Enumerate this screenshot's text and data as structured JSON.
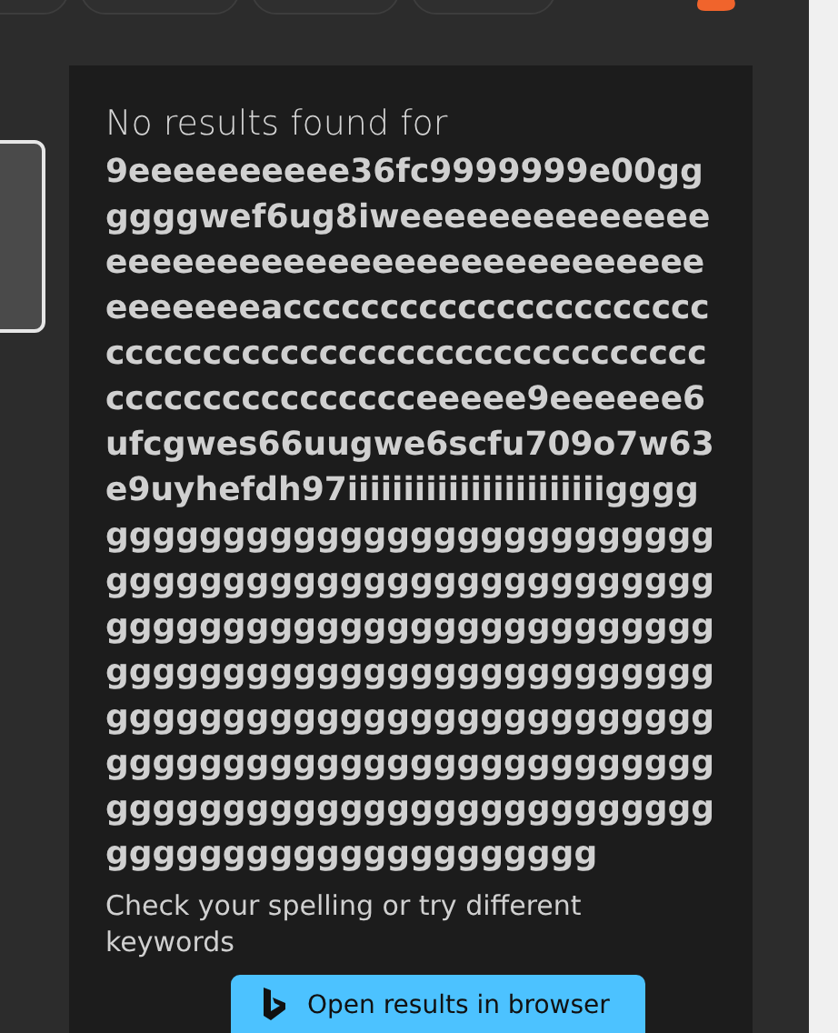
{
  "results_panel": {
    "heading": "No results found for",
    "query": "9eeeeeeeeee36fc9999999e00ggggggwef6ug8iweeeeeeeeeeeeeeeeeeeeeeeeeeeeeeeeeeeeeeeeeeeeeeeeaccccccccccccccccccccccccccccccccccccccccccccccccccccccccccccccccccccceeeee9eeeeee6ufcgwes66uugwe6scfu709o7w63e9uyhefdh97iiiiiiiiiiiiiiiiiiiiiiiggggggggggggggggggggggggggggggggggggggggggggggggggggggggggggggggggggggggggggggggggggggggggggggggggggggggggggggggggggggggggggggggggggggggggggggggggggggggggggggggggggggggggggggggggggggggggggggggggggggggggggggg",
    "hint": "Check your spelling or try different keywords"
  },
  "open_button": {
    "label": "Open results in browser"
  }
}
